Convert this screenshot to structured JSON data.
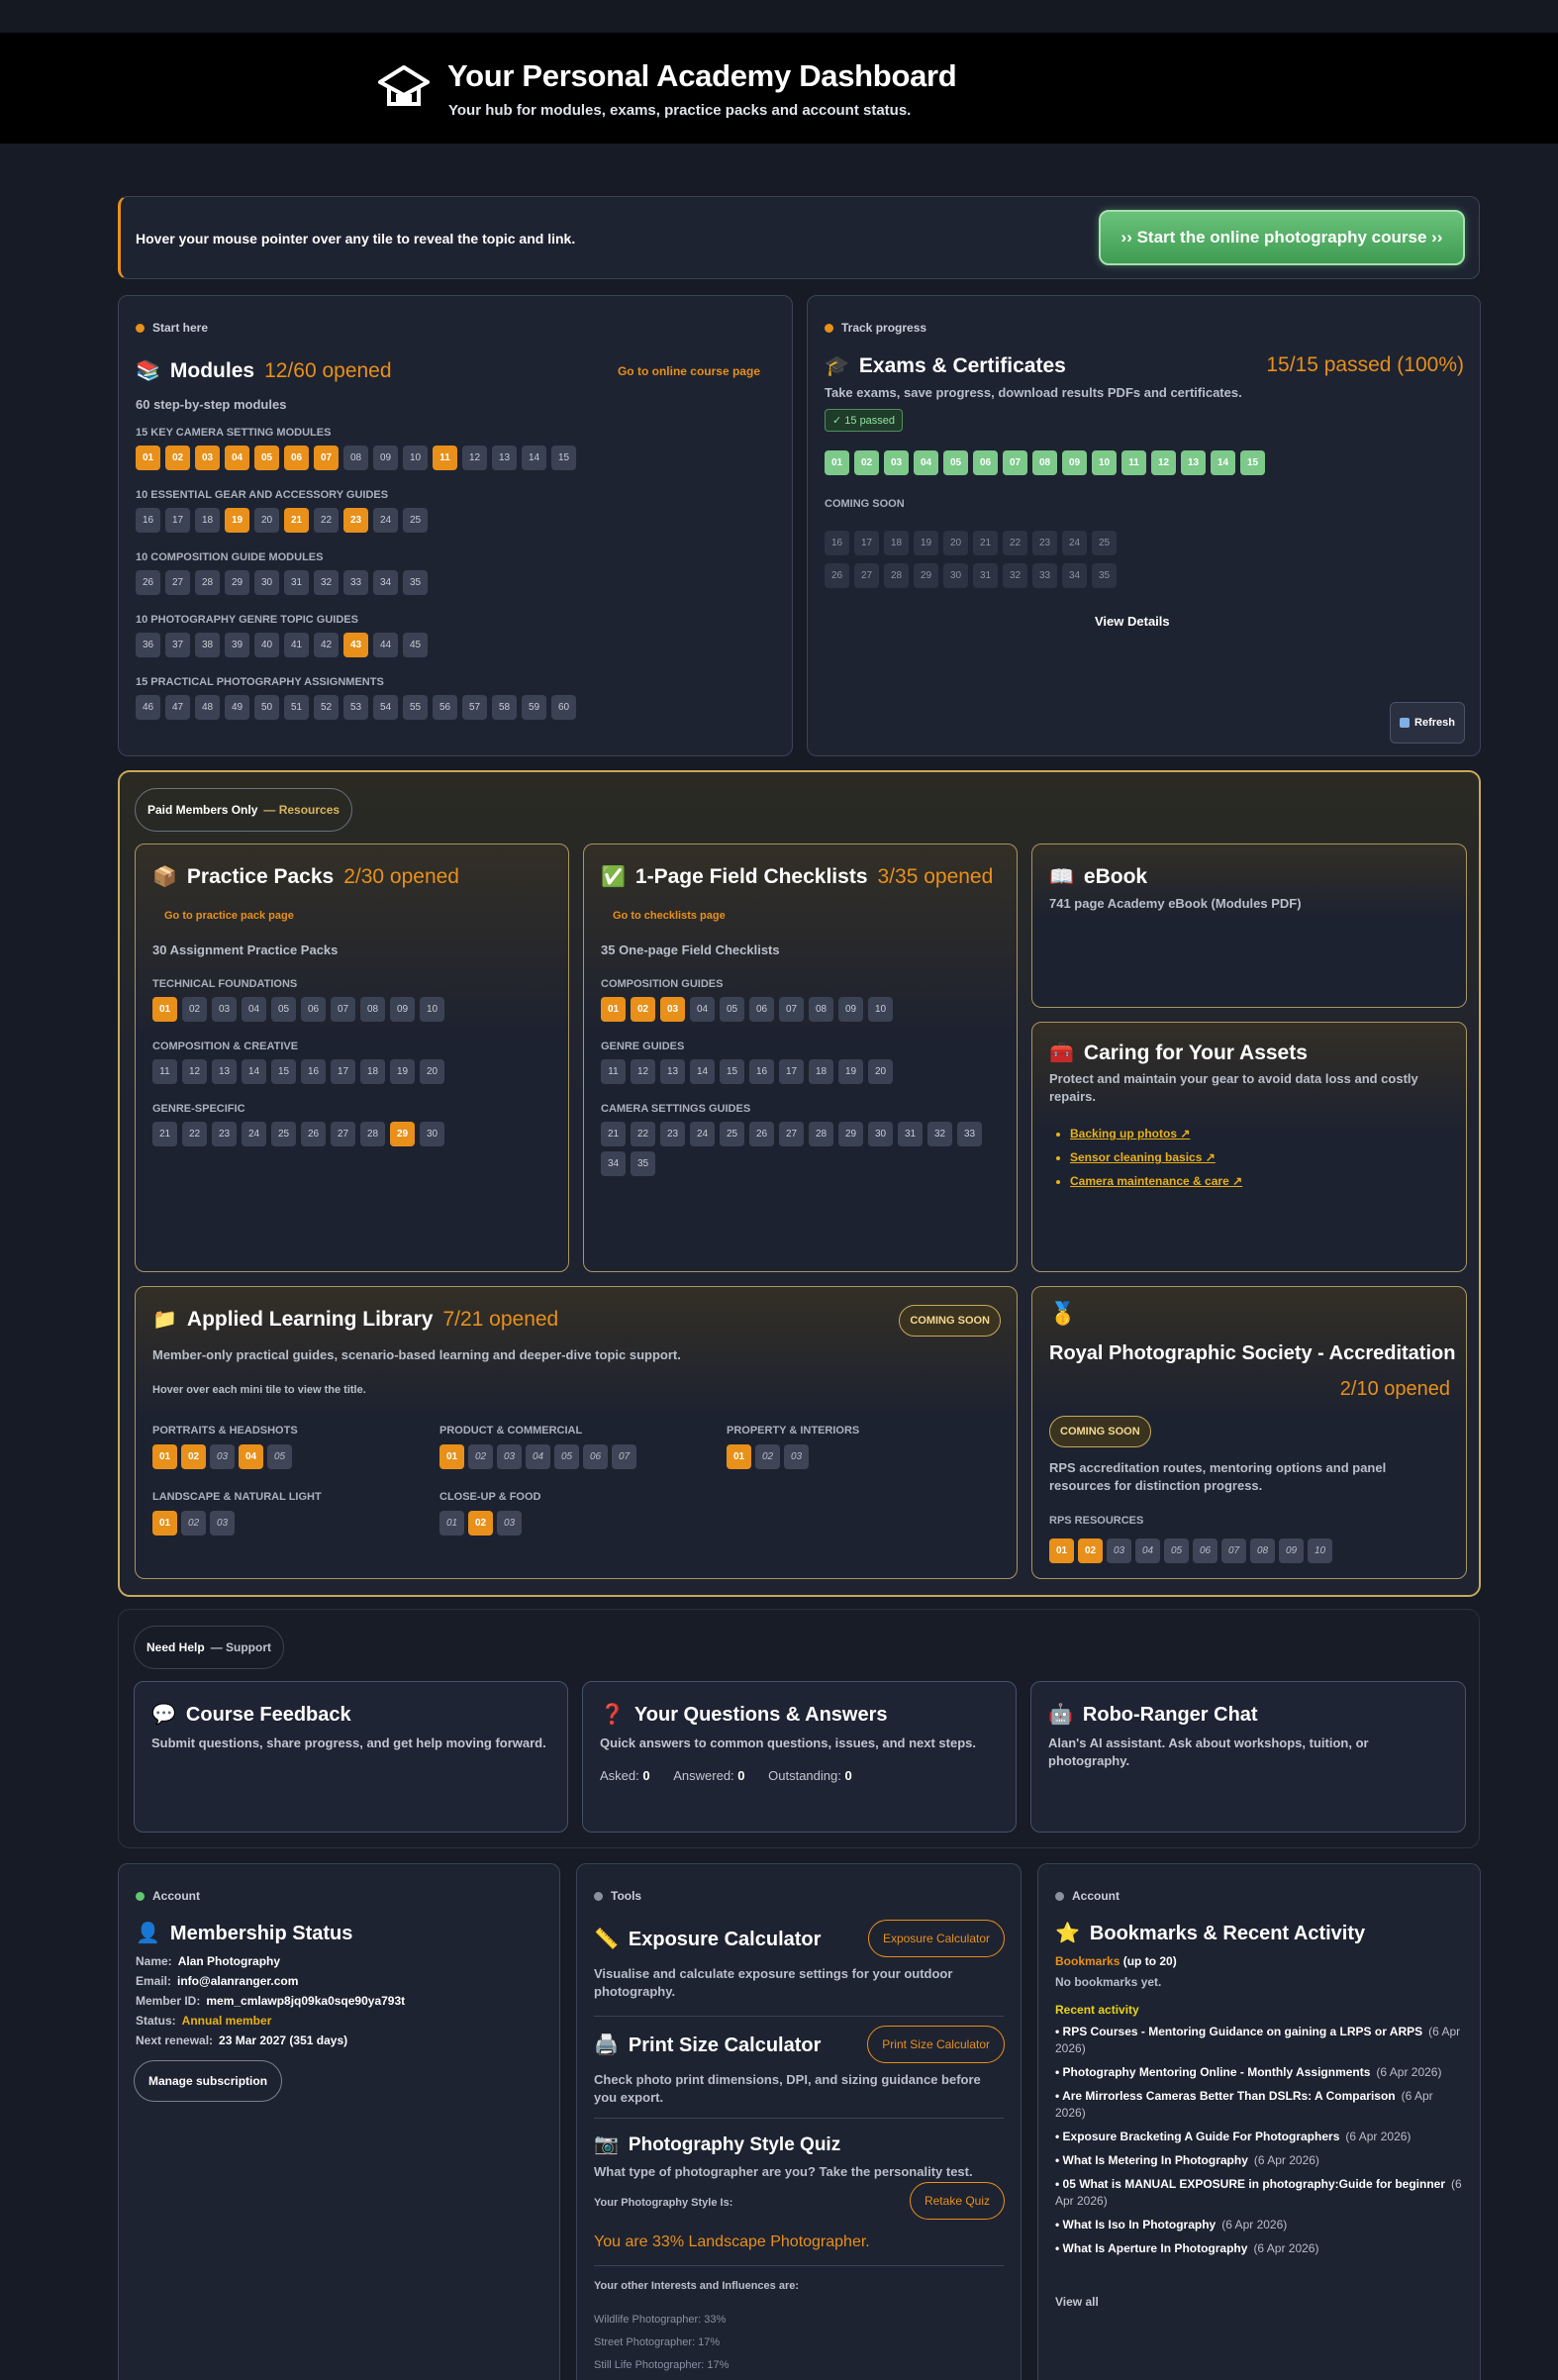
{
  "header": {
    "title": "Your Personal Academy Dashboard",
    "subtitle": "Your hub for modules, exams, practice packs and account status."
  },
  "hint": {
    "text": "Hover your mouse pointer over any tile to reveal the topic and link.",
    "cta": "›› Start the online photography course ››"
  },
  "modules": {
    "kicker": "Start here",
    "title": "Modules",
    "count": "12/60 opened",
    "link": "Go to online course page",
    "subtitle": "60 step-by-step modules",
    "sections": [
      {
        "label": "15 KEY CAMERA SETTING MODULES",
        "tiles": [
          [
            "01",
            1
          ],
          [
            "02",
            1
          ],
          [
            "03",
            1
          ],
          [
            "04",
            1
          ],
          [
            "05",
            1
          ],
          [
            "06",
            1
          ],
          [
            "07",
            1
          ],
          [
            "08",
            0
          ],
          [
            "09",
            0
          ],
          [
            "10",
            0
          ],
          [
            "11",
            1
          ],
          [
            "12",
            0
          ],
          [
            "13",
            0
          ],
          [
            "14",
            0
          ],
          [
            "15",
            0
          ]
        ]
      },
      {
        "label": "10 ESSENTIAL GEAR AND ACCESSORY GUIDES",
        "tiles": [
          [
            "16",
            0
          ],
          [
            "17",
            0
          ],
          [
            "18",
            0
          ],
          [
            "19",
            1
          ],
          [
            "20",
            0
          ],
          [
            "21",
            1
          ],
          [
            "22",
            0
          ],
          [
            "23",
            1
          ],
          [
            "24",
            0
          ],
          [
            "25",
            0
          ]
        ]
      },
      {
        "label": "10 COMPOSITION GUIDE MODULES",
        "tiles": [
          [
            "26",
            0
          ],
          [
            "27",
            0
          ],
          [
            "28",
            0
          ],
          [
            "29",
            0
          ],
          [
            "30",
            0
          ],
          [
            "31",
            0
          ],
          [
            "32",
            0
          ],
          [
            "33",
            0
          ],
          [
            "34",
            0
          ],
          [
            "35",
            0
          ]
        ]
      },
      {
        "label": "10 PHOTOGRAPHY GENRE TOPIC GUIDES",
        "tiles": [
          [
            "36",
            0
          ],
          [
            "37",
            0
          ],
          [
            "38",
            0
          ],
          [
            "39",
            0
          ],
          [
            "40",
            0
          ],
          [
            "41",
            0
          ],
          [
            "42",
            0
          ],
          [
            "43",
            1
          ],
          [
            "44",
            0
          ],
          [
            "45",
            0
          ]
        ]
      },
      {
        "label": "15 PRACTICAL PHOTOGRAPHY ASSIGNMENTS",
        "tiles": [
          [
            "46",
            0
          ],
          [
            "47",
            0
          ],
          [
            "48",
            0
          ],
          [
            "49",
            0
          ],
          [
            "50",
            0
          ],
          [
            "51",
            0
          ],
          [
            "52",
            0
          ],
          [
            "53",
            0
          ],
          [
            "54",
            0
          ],
          [
            "55",
            0
          ],
          [
            "56",
            0
          ],
          [
            "57",
            0
          ],
          [
            "58",
            0
          ],
          [
            "59",
            0
          ],
          [
            "60",
            0
          ]
        ]
      }
    ]
  },
  "exams": {
    "kicker": "Track progress",
    "title": "Exams & Certificates",
    "count": "15/15 passed (100%)",
    "subtitle": "Take exams, save progress, download results PDFs and certificates.",
    "passed_badge": "✓ 15 passed",
    "passed": [
      "01",
      "02",
      "03",
      "04",
      "05",
      "06",
      "07",
      "08",
      "09",
      "10",
      "11",
      "12",
      "13",
      "14",
      "15"
    ],
    "coming_label": "COMING SOON",
    "coming_row1": [
      "16",
      "17",
      "18",
      "19",
      "20",
      "21",
      "22",
      "23",
      "24",
      "25"
    ],
    "coming_row2": [
      "26",
      "27",
      "28",
      "29",
      "30",
      "31",
      "32",
      "33",
      "34",
      "35"
    ],
    "details": "View Details",
    "refresh": "Refresh"
  },
  "resources": {
    "pill": "Paid Members Only",
    "pill_suffix": "— Resources",
    "practice": {
      "title": "Practice Packs",
      "count": "2/30 opened",
      "link": "Go to practice pack page",
      "subtitle": "30 Assignment Practice Packs",
      "sections": [
        {
          "label": "TECHNICAL FOUNDATIONS",
          "tiles": [
            [
              "01",
              1
            ],
            [
              "02",
              0
            ],
            [
              "03",
              0
            ],
            [
              "04",
              0
            ],
            [
              "05",
              0
            ],
            [
              "06",
              0
            ],
            [
              "07",
              0
            ],
            [
              "08",
              0
            ],
            [
              "09",
              0
            ],
            [
              "10",
              0
            ]
          ]
        },
        {
          "label": "COMPOSITION & CREATIVE",
          "tiles": [
            [
              "11",
              0
            ],
            [
              "12",
              0
            ],
            [
              "13",
              0
            ],
            [
              "14",
              0
            ],
            [
              "15",
              0
            ],
            [
              "16",
              0
            ],
            [
              "17",
              0
            ],
            [
              "18",
              0
            ],
            [
              "19",
              0
            ],
            [
              "20",
              0
            ]
          ]
        },
        {
          "label": "GENRE-SPECIFIC",
          "tiles": [
            [
              "21",
              0
            ],
            [
              "22",
              0
            ],
            [
              "23",
              0
            ],
            [
              "24",
              0
            ],
            [
              "25",
              0
            ],
            [
              "26",
              0
            ],
            [
              "27",
              0
            ],
            [
              "28",
              0
            ],
            [
              "29",
              1
            ],
            [
              "30",
              0
            ]
          ]
        }
      ]
    },
    "checklists": {
      "title": "1-Page Field Checklists",
      "count": "3/35 opened",
      "link": "Go to checklists page",
      "subtitle": "35 One-page Field Checklists",
      "sections": [
        {
          "label": "COMPOSITION GUIDES",
          "tiles": [
            [
              "01",
              1
            ],
            [
              "02",
              1
            ],
            [
              "03",
              1
            ],
            [
              "04",
              0
            ],
            [
              "05",
              0
            ],
            [
              "06",
              0
            ],
            [
              "07",
              0
            ],
            [
              "08",
              0
            ],
            [
              "09",
              0
            ],
            [
              "10",
              0
            ]
          ]
        },
        {
          "label": "GENRE GUIDES",
          "tiles": [
            [
              "11",
              0
            ],
            [
              "12",
              0
            ],
            [
              "13",
              0
            ],
            [
              "14",
              0
            ],
            [
              "15",
              0
            ],
            [
              "16",
              0
            ],
            [
              "17",
              0
            ],
            [
              "18",
              0
            ],
            [
              "19",
              0
            ],
            [
              "20",
              0
            ]
          ]
        },
        {
          "label": "CAMERA SETTINGS GUIDES",
          "tiles": [
            [
              "21",
              0
            ],
            [
              "22",
              0
            ],
            [
              "23",
              0
            ],
            [
              "24",
              0
            ],
            [
              "25",
              0
            ],
            [
              "26",
              0
            ],
            [
              "27",
              0
            ],
            [
              "28",
              0
            ],
            [
              "29",
              0
            ],
            [
              "30",
              0
            ],
            [
              "31",
              0
            ],
            [
              "32",
              0
            ],
            [
              "33",
              0
            ],
            [
              "34",
              0
            ],
            [
              "35",
              0
            ]
          ]
        }
      ]
    },
    "ebook": {
      "title": "eBook",
      "subtitle": "741 page Academy eBook (Modules PDF)"
    },
    "assets": {
      "title": "Caring for Your Assets",
      "desc": "Protect and maintain your gear to avoid data loss and costly repairs.",
      "links": [
        "Backing up photos ↗",
        "Sensor cleaning basics ↗",
        "Camera maintenance & care ↗"
      ]
    },
    "library": {
      "title": "Applied Learning Library",
      "count": "7/21 opened",
      "badge": "COMING SOON",
      "desc": "Member-only practical guides, scenario-based learning and deeper-dive topic support.",
      "hint": "Hover over each mini tile to view the title.",
      "groups": [
        {
          "label": "PORTRAITS & HEADSHOTS",
          "tiles": [
            [
              "01",
              1
            ],
            [
              "02",
              1
            ],
            [
              "03",
              0
            ],
            [
              "04",
              1
            ],
            [
              "05",
              0
            ]
          ]
        },
        {
          "label": "PRODUCT & COMMERCIAL",
          "tiles": [
            [
              "01",
              1
            ],
            [
              "02",
              0
            ],
            [
              "03",
              0
            ],
            [
              "04",
              0
            ],
            [
              "05",
              0
            ],
            [
              "06",
              0
            ],
            [
              "07",
              0
            ]
          ]
        },
        {
          "label": "PROPERTY & INTERIORS",
          "tiles": [
            [
              "01",
              1
            ],
            [
              "02",
              0
            ],
            [
              "03",
              0
            ]
          ]
        },
        {
          "label": "LANDSCAPE & NATURAL LIGHT",
          "tiles": [
            [
              "01",
              1
            ],
            [
              "02",
              0
            ],
            [
              "03",
              0
            ]
          ]
        },
        {
          "label": "CLOSE-UP & FOOD",
          "tiles": [
            [
              "01",
              0
            ],
            [
              "02",
              1
            ],
            [
              "03",
              0
            ]
          ]
        }
      ]
    },
    "rps": {
      "title": "Royal Photographic Society - Accreditation",
      "count": "2/10 opened",
      "badge": "COMING SOON",
      "desc": "RPS accreditation routes, mentoring options and panel resources for distinction progress.",
      "section": "RPS RESOURCES",
      "tiles": [
        [
          "01",
          1
        ],
        [
          "02",
          1
        ],
        [
          "03",
          0
        ],
        [
          "04",
          0
        ],
        [
          "05",
          0
        ],
        [
          "06",
          0
        ],
        [
          "07",
          0
        ],
        [
          "08",
          0
        ],
        [
          "09",
          0
        ],
        [
          "10",
          0
        ]
      ]
    }
  },
  "support": {
    "pill": "Need Help",
    "pill_suffix": "— Support",
    "feedback": {
      "title": "Course Feedback",
      "desc": "Submit questions, share progress, and get help moving forward."
    },
    "qa": {
      "title": "Your Questions & Answers",
      "desc": "Quick answers to common questions, issues, and next steps.",
      "asked_label": "Asked:",
      "asked": "0",
      "answered_label": "Answered:",
      "answered": "0",
      "outstanding_label": "Outstanding:",
      "outstanding": "0"
    },
    "chat": {
      "title": "Robo-Ranger Chat",
      "desc": "Alan's AI assistant. Ask about workshops, tuition, or photography."
    }
  },
  "membership": {
    "kicker": "Account",
    "title": "Membership Status",
    "name_label": "Name:",
    "name": "Alan Photography",
    "email_label": "Email:",
    "email": "info@alanranger.com",
    "id_label": "Member ID:",
    "id": "mem_cmlawp8jq09ka0sqe90ya793t",
    "status_label": "Status:",
    "status": "Annual member",
    "renewal_label": "Next renewal:",
    "renewal": "23 Mar 2027 (351 days)",
    "manage": "Manage subscription"
  },
  "tools": {
    "kicker": "Tools",
    "exposure": {
      "title": "Exposure Calculator",
      "button": "Exposure Calculator",
      "desc": "Visualise and calculate exposure settings for your outdoor photography."
    },
    "print": {
      "title": "Print Size Calculator",
      "button": "Print Size Calculator",
      "desc": "Check photo print dimensions, DPI, and sizing guidance before you export."
    },
    "quiz": {
      "title": "Photography Style Quiz",
      "desc": "What type of photographer are you? Take the personality test.",
      "style_label": "Your Photography Style Is:",
      "button": "Retake Quiz",
      "result": "You are 33% Landscape Photographer.",
      "others_label": "Your other Interests and Influences are:",
      "others": [
        "Wildlife Photographer: 33%",
        "Street Photographer: 17%",
        "Still Life Photographer: 17%"
      ]
    }
  },
  "bookmarks": {
    "kicker": "Account",
    "title": "Bookmarks & Recent Activity",
    "label": "Bookmarks",
    "limit": "(up to 20)",
    "empty": "No bookmarks yet.",
    "recent_label": "Recent activity",
    "items": [
      {
        "t": "RPS Courses - Mentoring Guidance on gaining a LRPS or ARPS",
        "d": "(6 Apr 2026)"
      },
      {
        "t": "Photography Mentoring Online - Monthly Assignments",
        "d": "(6 Apr 2026)"
      },
      {
        "t": "Are Mirrorless Cameras Better Than DSLRs: A Comparison",
        "d": "(6 Apr 2026)"
      },
      {
        "t": "Exposure Bracketing A Guide For Photographers",
        "d": "(6 Apr 2026)"
      },
      {
        "t": "What Is Metering In Photography",
        "d": "(6 Apr 2026)"
      },
      {
        "t": "05 What is MANUAL EXPOSURE in photography:Guide for beginner",
        "d": "(6 Apr 2026)"
      },
      {
        "t": "What Is Iso In Photography",
        "d": "(6 Apr 2026)"
      },
      {
        "t": "What Is Aperture In Photography",
        "d": "(6 Apr 2026)"
      }
    ],
    "view_all": "View all"
  }
}
